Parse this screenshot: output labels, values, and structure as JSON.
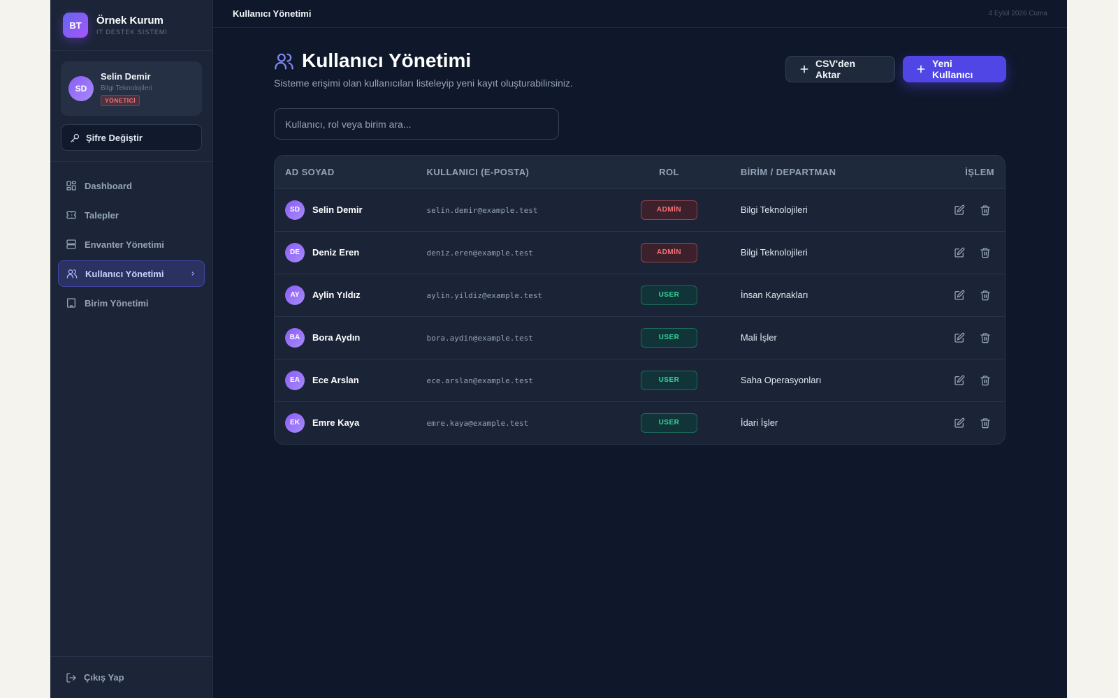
{
  "brand": {
    "logo": "BT",
    "name": "Örnek Kurum",
    "subtitle": "IT DESTEK SİSTEMİ"
  },
  "current_user": {
    "initials": "SD",
    "name": "Selin Demir",
    "department": "Bilgi Teknolojileri",
    "role": "YÖNETİCİ"
  },
  "sidebar": {
    "change_password": "Şifre Değiştir",
    "items": [
      {
        "label": "Dashboard",
        "icon": "grid-icon",
        "active": false
      },
      {
        "label": "Talepler",
        "icon": "ticket-icon",
        "active": false
      },
      {
        "label": "Envanter Yönetimi",
        "icon": "server-icon",
        "active": false
      },
      {
        "label": "Kullanıcı Yönetimi",
        "icon": "users-icon",
        "active": true
      },
      {
        "label": "Birim Yönetimi",
        "icon": "building-icon",
        "active": false
      }
    ],
    "logout": "Çıkış Yap"
  },
  "topbar": {
    "title": "Kullanıcı Yönetimi",
    "date": "4 Eylül 2026 Cuma"
  },
  "page": {
    "title": "Kullanıcı Yönetimi",
    "subtitle": "Sisteme erişimi olan kullanıcıları listeleyip yeni kayıt oluşturabilirsiniz.",
    "import_button": "CSV'den Aktar",
    "new_button": "Yeni Kullanıcı",
    "search_placeholder": "Kullanıcı, rol veya birim ara..."
  },
  "table": {
    "headers": [
      "AD SOYAD",
      "KULLANICI (E-POSTA)",
      "ROL",
      "BİRİM / DEPARTMAN",
      "İŞLEM"
    ],
    "rows": [
      {
        "initials": "SD",
        "name": "Selin Demir",
        "email": "selin.demir@example.test",
        "role": "ADMİN",
        "department": "Bilgi Teknolojileri"
      },
      {
        "initials": "DE",
        "name": "Deniz Eren",
        "email": "deniz.eren@example.test",
        "role": "ADMİN",
        "department": "Bilgi Teknolojileri"
      },
      {
        "initials": "AY",
        "name": "Aylin Yıldız",
        "email": "aylin.yildiz@example.test",
        "role": "USER",
        "department": "İnsan Kaynakları"
      },
      {
        "initials": "BA",
        "name": "Bora Aydın",
        "email": "bora.aydin@example.test",
        "role": "USER",
        "department": "Mali İşler"
      },
      {
        "initials": "EA",
        "name": "Ece Arslan",
        "email": "ece.arslan@example.test",
        "role": "USER",
        "department": "Saha Operasyonları"
      },
      {
        "initials": "EK",
        "name": "Emre Kaya",
        "email": "emre.kaya@example.test",
        "role": "USER",
        "department": "İdari İşler"
      }
    ]
  },
  "colors": {
    "accent": "#4f46e5",
    "background": "#0f172a",
    "admin_badge": "#f87171",
    "user_badge": "#34d399"
  }
}
